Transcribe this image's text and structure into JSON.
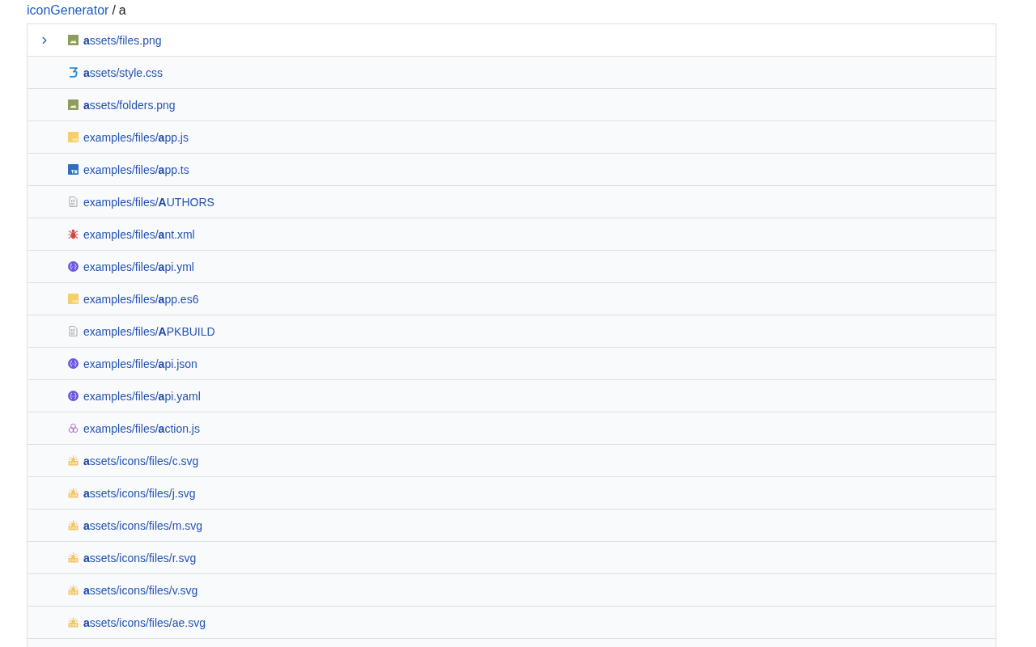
{
  "breadcrumb": {
    "link": "iconGenerator",
    "separator": "/",
    "query": "a"
  },
  "files": [
    {
      "path": "**a**ssets/files.png",
      "kind": "image",
      "selected": true
    },
    {
      "path": "**a**ssets/style.css",
      "kind": "css",
      "selected": false
    },
    {
      "path": "**a**ssets/folders.png",
      "kind": "image",
      "selected": false
    },
    {
      "path": "examples/files/**a**pp.js",
      "kind": "js",
      "selected": false
    },
    {
      "path": "examples/files/**a**pp.ts",
      "kind": "ts",
      "selected": false
    },
    {
      "path": "examples/files/**A**UTHORS",
      "kind": "binary",
      "selected": false
    },
    {
      "path": "examples/files/**a**nt.xml",
      "kind": "ant",
      "selected": false
    },
    {
      "path": "examples/files/**a**pi.yml",
      "kind": "openapi",
      "selected": false
    },
    {
      "path": "examples/files/**a**pp.es6",
      "kind": "js",
      "selected": false
    },
    {
      "path": "examples/files/**A**PKBUILD",
      "kind": "binary",
      "selected": false
    },
    {
      "path": "examples/files/**a**pi.json",
      "kind": "openapi",
      "selected": false
    },
    {
      "path": "examples/files/**a**pi.yaml",
      "kind": "openapi",
      "selected": false
    },
    {
      "path": "examples/files/**a**ction.js",
      "kind": "action",
      "selected": false
    },
    {
      "path": "**a**ssets/icons/files/c.svg",
      "kind": "svg",
      "selected": false
    },
    {
      "path": "**a**ssets/icons/files/j.svg",
      "kind": "svg",
      "selected": false
    },
    {
      "path": "**a**ssets/icons/files/m.svg",
      "kind": "svg",
      "selected": false
    },
    {
      "path": "**a**ssets/icons/files/r.svg",
      "kind": "svg",
      "selected": false
    },
    {
      "path": "**a**ssets/icons/files/v.svg",
      "kind": "svg",
      "selected": false
    },
    {
      "path": "**a**ssets/icons/files/ae.svg",
      "kind": "svg",
      "selected": false
    }
  ]
}
